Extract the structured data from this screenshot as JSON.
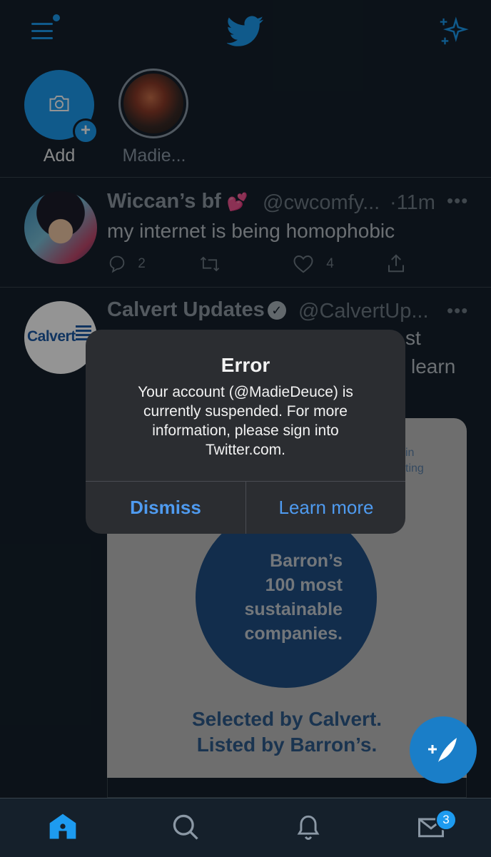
{
  "fleets": {
    "add_label": "Add",
    "user_label": "Madie..."
  },
  "tweets": [
    {
      "name": "Wiccan’s bf",
      "emoji": "💕",
      "handle": "@cwcomfy...",
      "time": "·11m",
      "text": "my internet is being homophobic",
      "replies": "2",
      "likes": "4"
    },
    {
      "name": "Calvert Updates",
      "handle": "@CalvertUp...",
      "avatar_logo": "Calvert",
      "text_fragment_1": "st",
      "text_fragment_2": "learn",
      "media_fragment_1": "in",
      "media_fragment_2": "sting",
      "media_circle": [
        "Barron’s",
        "100 most",
        "sustainable",
        "companies."
      ],
      "media_caption": [
        "Selected by Calvert.",
        "Listed by Barron’s."
      ]
    }
  ],
  "alert": {
    "title": "Error",
    "message": "Your account (@MadieDeuce) is currently suspended. For more information, please sign into Twitter.com.",
    "dismiss_label": "Dismiss",
    "learn_more_label": "Learn more"
  },
  "tabbar": {
    "messages_badge": "3"
  },
  "colors": {
    "background": "#15202b",
    "accent": "#1d9bf0",
    "alert_bg": "#2b2d31",
    "link": "#4f9bf0"
  },
  "icons": [
    "menu-icon",
    "twitter-bird-icon",
    "sparkle-icon",
    "camera-icon",
    "reply-icon",
    "retweet-icon",
    "like-icon",
    "share-icon",
    "compose-icon",
    "home-icon",
    "search-icon",
    "notifications-icon",
    "messages-icon"
  ]
}
